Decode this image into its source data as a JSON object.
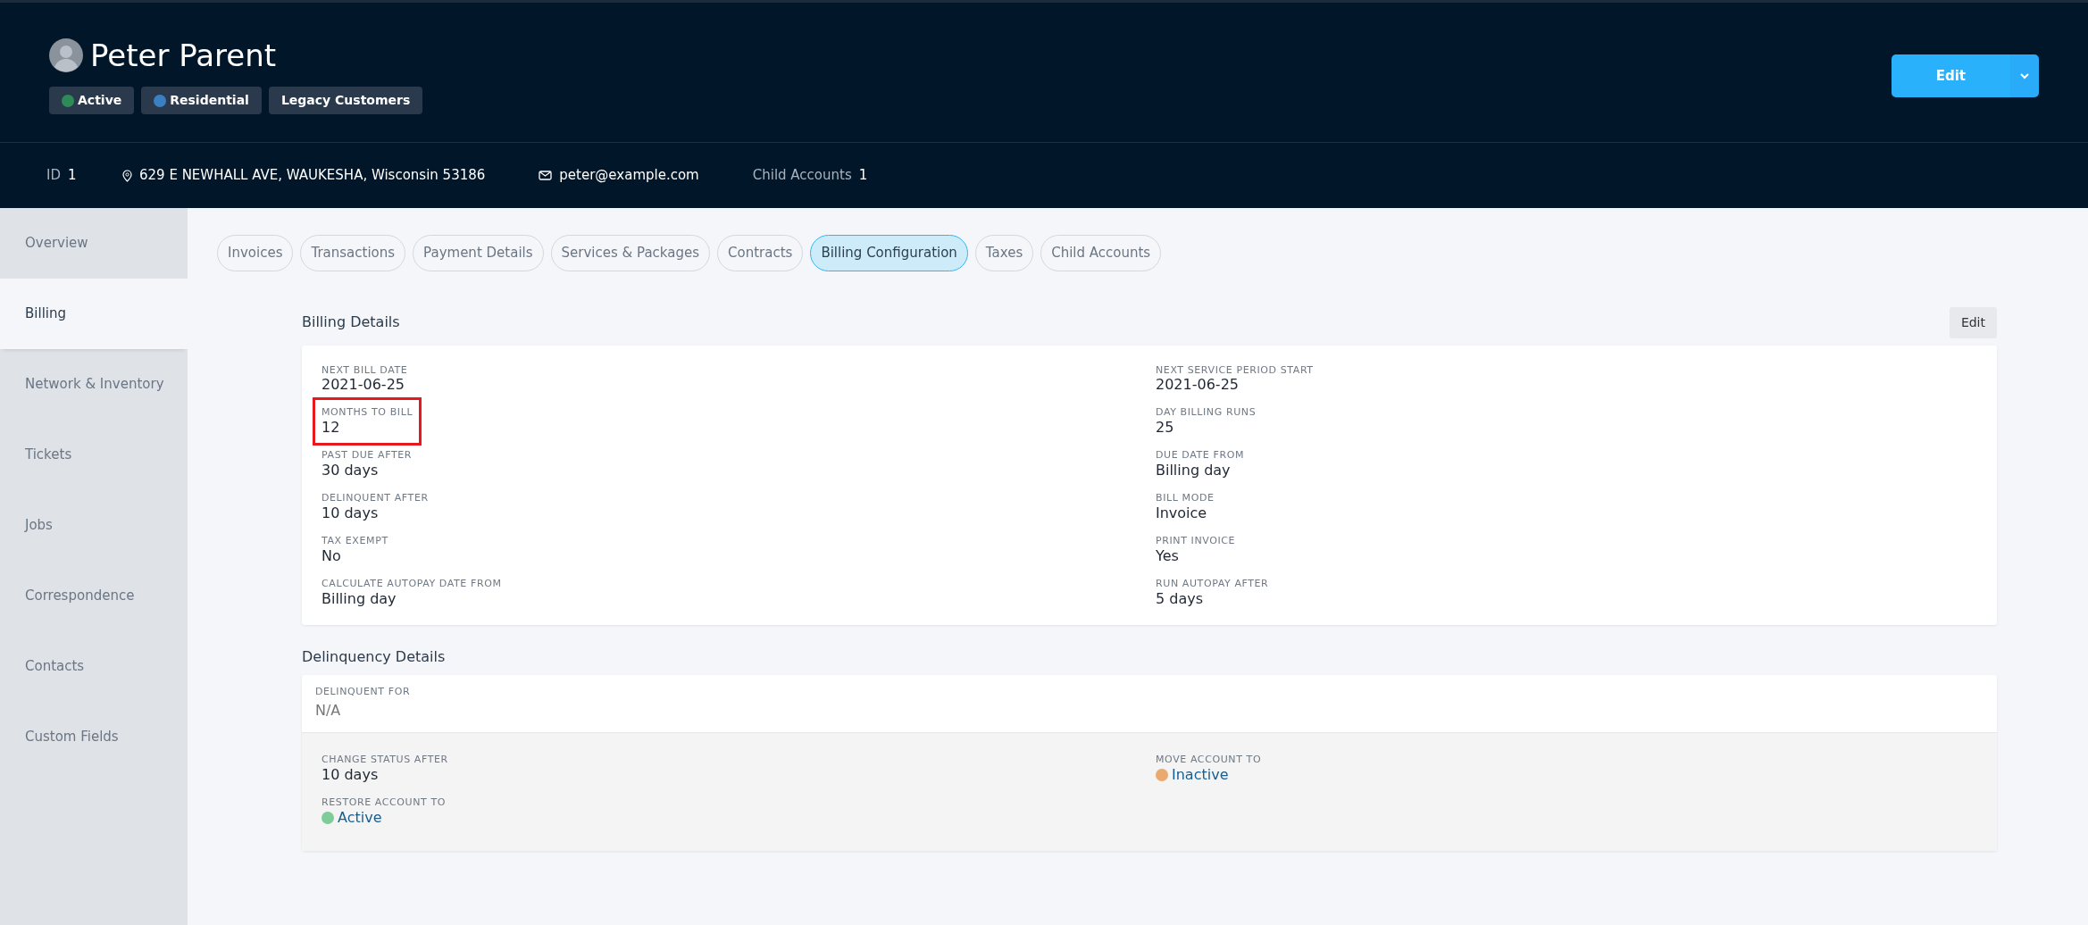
{
  "customer": {
    "name": "Peter Parent",
    "tags": [
      {
        "label": "Active",
        "color": "#2e8b57"
      },
      {
        "label": "Residential",
        "color": "#3a7fc1"
      },
      {
        "label": "Legacy Customers"
      }
    ]
  },
  "header_actions": {
    "edit_button": "Edit"
  },
  "info_bar": {
    "id_label": "ID",
    "id_value": "1",
    "address": "629 E NEWHALL AVE, WAUKESHA, Wisconsin 53186",
    "email": "peter@example.com",
    "child_accounts_label": "Child Accounts",
    "child_accounts_value": "1"
  },
  "sidebar": {
    "items": [
      {
        "label": "Overview",
        "selected": false
      },
      {
        "label": "Billing",
        "selected": true
      },
      {
        "label": "Network & Inventory",
        "selected": false
      },
      {
        "label": "Tickets",
        "selected": false
      },
      {
        "label": "Jobs",
        "selected": false
      },
      {
        "label": "Correspondence",
        "selected": false
      },
      {
        "label": "Contacts",
        "selected": false
      },
      {
        "label": "Custom Fields",
        "selected": false
      }
    ]
  },
  "tabs": [
    {
      "label": "Invoices",
      "selected": false
    },
    {
      "label": "Transactions",
      "selected": false
    },
    {
      "label": "Payment Details",
      "selected": false
    },
    {
      "label": "Services & Packages",
      "selected": false
    },
    {
      "label": "Contracts",
      "selected": false
    },
    {
      "label": "Billing Configuration",
      "selected": true
    },
    {
      "label": "Taxes",
      "selected": false
    },
    {
      "label": "Child Accounts",
      "selected": false
    }
  ],
  "billing_details": {
    "title": "Billing Details",
    "edit_button": "Edit",
    "left_fields": [
      {
        "label": "NEXT BILL DATE",
        "value": "2021-06-25",
        "highlighted": false
      },
      {
        "label": "MONTHS TO BILL",
        "value": "12",
        "highlighted": true
      },
      {
        "label": "PAST DUE AFTER",
        "value": "30 days",
        "highlighted": false
      },
      {
        "label": "DELINQUENT AFTER",
        "value": "10 days",
        "highlighted": false
      },
      {
        "label": "TAX EXEMPT",
        "value": "No",
        "highlighted": false
      },
      {
        "label": "CALCULATE AUTOPAY DATE FROM",
        "value": "Billing day",
        "highlighted": false
      }
    ],
    "right_fields": [
      {
        "label": "NEXT SERVICE PERIOD START",
        "value": "2021-06-25",
        "highlighted": false
      },
      {
        "label": "DAY BILLING RUNS",
        "value": "25",
        "highlighted": false
      },
      {
        "label": "DUE DATE FROM",
        "value": "Billing day",
        "highlighted": false
      },
      {
        "label": "BILL MODE",
        "value": "Invoice",
        "highlighted": false
      },
      {
        "label": "PRINT INVOICE",
        "value": "Yes",
        "highlighted": false
      },
      {
        "label": "RUN AUTOPAY AFTER",
        "value": "5 days",
        "highlighted": false
      }
    ]
  },
  "delinquency_details": {
    "title": "Delinquency Details",
    "delinquent_for": {
      "label": "DELINQUENT FOR",
      "value": "N/A"
    },
    "left_fields": [
      {
        "kind": "text",
        "label": "CHANGE STATUS AFTER",
        "value": "10 days"
      },
      {
        "kind": "status",
        "label": "RESTORE ACCOUNT TO",
        "value": "Active",
        "color": "#7dcc9a"
      }
    ],
    "right_fields": [
      {
        "kind": "status",
        "label": "MOVE ACCOUNT TO",
        "value": "Inactive",
        "color": "#eaa96e"
      }
    ]
  }
}
